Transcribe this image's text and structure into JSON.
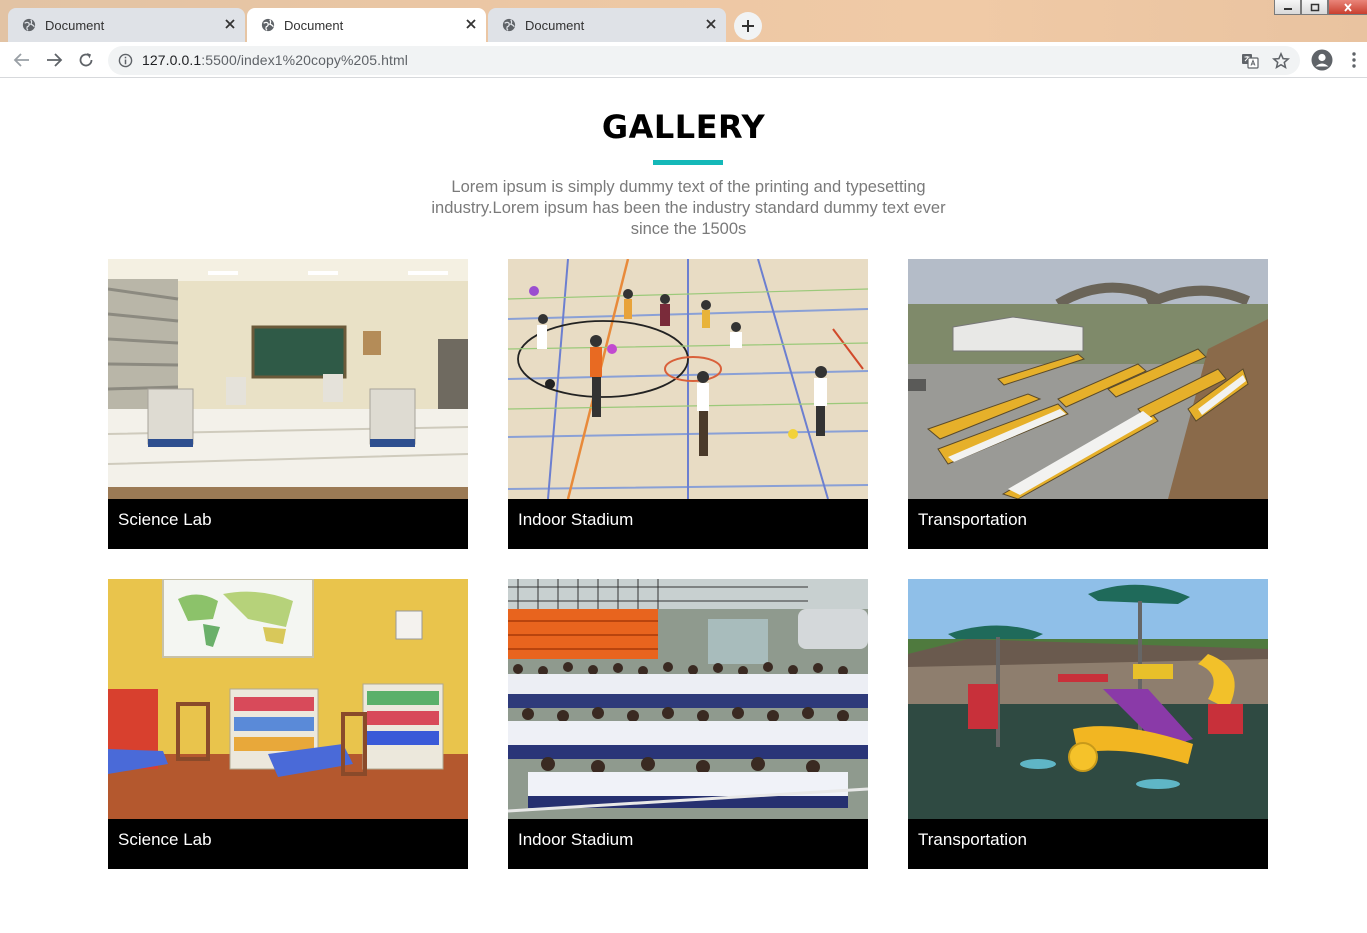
{
  "browser": {
    "tabs": [
      {
        "title": "Document",
        "active": false
      },
      {
        "title": "Document",
        "active": true
      },
      {
        "title": "Document",
        "active": false
      }
    ],
    "url_host": "127.0.0.1",
    "url_rest": ":5500/index1%20copy%205.html"
  },
  "gallery": {
    "title": "GALLERY",
    "accent_color": "#14b8b8",
    "intro": "Lorem ipsum is simply dummy text of the printing and typesetting industry.Lorem ipsum has been the industry standard dummy text ever since the 1500s",
    "items": [
      {
        "caption": "Science Lab",
        "image": "science-lab-classroom-photo"
      },
      {
        "caption": "Indoor Stadium",
        "image": "indoor-gym-children-playing-photo"
      },
      {
        "caption": "Transportation",
        "image": "school-buses-parked-photo"
      },
      {
        "caption": "Science Lab",
        "image": "kindergarten-classroom-photo"
      },
      {
        "caption": "Indoor Stadium",
        "image": "students-seated-assembly-photo"
      },
      {
        "caption": "Transportation",
        "image": "playground-slides-photo"
      }
    ]
  }
}
